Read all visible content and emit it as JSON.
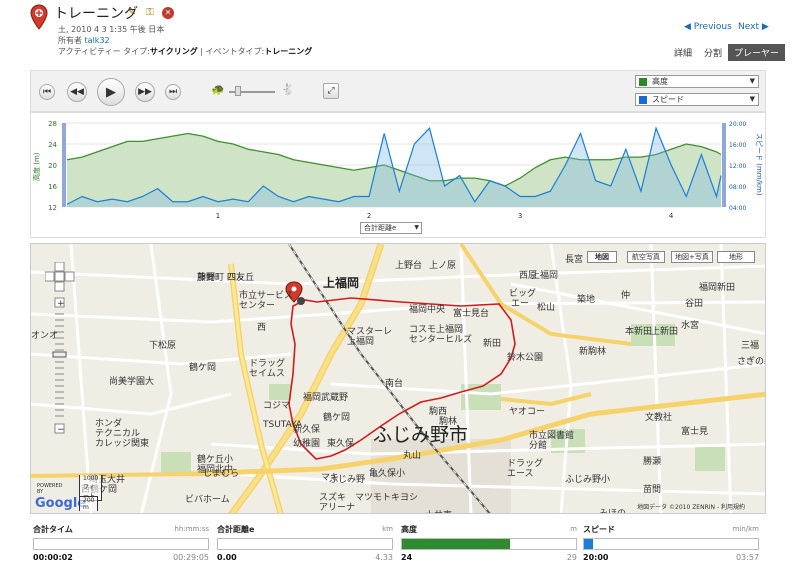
{
  "header": {
    "title": "トレーニング",
    "datetime": "土, 2010 4 3 1:35 午後 日本",
    "owner_label": "所有者",
    "owner_name": "talk32",
    "activity_type_label": "アクティビティー タイプ:",
    "activity_type": "サイクリング",
    "event_type_label": "| イベントタイプ:",
    "event_type": "トレーニング",
    "prev": "◀ Previous",
    "next": "Next ▶",
    "tabs": [
      "詳細",
      "分割",
      "プレーヤー"
    ],
    "active_tab": 2
  },
  "player": {
    "dropdown1": "高度",
    "dropdown2": "スピード",
    "color1": "#2a8a2a",
    "color2": "#1a6bd8"
  },
  "chart_data": {
    "type": "area",
    "series": [
      {
        "name": "高度",
        "unit": "m",
        "color": "#3f8f2f",
        "x": [
          0,
          0.1,
          0.2,
          0.3,
          0.4,
          0.5,
          0.6,
          0.7,
          0.8,
          0.9,
          1.0,
          1.1,
          1.2,
          1.3,
          1.4,
          1.5,
          1.6,
          1.7,
          1.8,
          1.9,
          2.0,
          2.1,
          2.2,
          2.3,
          2.4,
          2.5,
          2.6,
          2.7,
          2.8,
          2.9,
          3.0,
          3.1,
          3.2,
          3.3,
          3.4,
          3.5,
          3.6,
          3.7,
          3.8,
          3.9,
          4.0,
          4.1,
          4.2,
          4.3,
          4.33
        ],
        "values": [
          21,
          21.5,
          22.5,
          23.5,
          24.5,
          24.5,
          25,
          25.5,
          26,
          25.5,
          24.5,
          24,
          23,
          22.5,
          22,
          21,
          20.5,
          20,
          19.5,
          19,
          19.5,
          20,
          19,
          18,
          17,
          17,
          17.5,
          17.5,
          17,
          16,
          17.5,
          19.5,
          21,
          21.5,
          21,
          21,
          21,
          21.5,
          21.5,
          22,
          23,
          24,
          23.5,
          22.5,
          22
        ]
      },
      {
        "name": "スピード",
        "unit": "mm/km",
        "color": "#1a7fd8",
        "x": [
          0,
          0.1,
          0.2,
          0.3,
          0.4,
          0.5,
          0.6,
          0.7,
          0.8,
          0.9,
          1.0,
          1.1,
          1.2,
          1.3,
          1.4,
          1.5,
          1.6,
          1.7,
          1.8,
          1.9,
          2.0,
          2.1,
          2.2,
          2.3,
          2.4,
          2.5,
          2.6,
          2.7,
          2.8,
          2.9,
          3.0,
          3.1,
          3.2,
          3.3,
          3.4,
          3.5,
          3.6,
          3.7,
          3.8,
          3.9,
          4.0,
          4.1,
          4.2,
          4.3,
          4.33
        ],
        "values": [
          4.5,
          6,
          5,
          5.5,
          5,
          6,
          7.5,
          5,
          5,
          6,
          5,
          5.5,
          5,
          8,
          6,
          5,
          6,
          5.5,
          5,
          6,
          6,
          18,
          7,
          16,
          19,
          8,
          10,
          5,
          9,
          8,
          6,
          6,
          7,
          12,
          18,
          9,
          8,
          15,
          7,
          19,
          12,
          6,
          14,
          6,
          10
        ]
      }
    ],
    "x_ticks": [
      "1",
      "2",
      "3",
      "4"
    ],
    "y_left_ticks": [
      "28",
      "24",
      "20",
      "16",
      "12"
    ],
    "y_right_ticks": [
      "20:00",
      "16:00",
      "12:00",
      "08:00",
      "04:00"
    ],
    "ylabel_left": "高度 (m)",
    "ylabel_right": "スピード (mm/km)",
    "ylim_left": [
      12,
      28
    ],
    "ylim_right": [
      4,
      20
    ],
    "xlim": [
      0,
      4.33
    ],
    "x_selector": "合計距離e"
  },
  "map": {
    "type_buttons": [
      "地図",
      "航空写真",
      "地図+写真",
      "地形"
    ],
    "labels": [
      {
        "t": "熊野町",
        "c": "mt"
      },
      {
        "t": "藤間",
        "c": "mt"
      },
      {
        "t": "四友",
        "c": "mt"
      },
      {
        "t": "四友丘",
        "c": "mt"
      },
      {
        "t": "上福岡",
        "c": "mid"
      },
      {
        "t": "市立サービス",
        "c": "mt"
      },
      {
        "t": "センター",
        "c": "mt"
      },
      {
        "t": "マスターレ",
        "c": "mt"
      },
      {
        "t": "上福岡",
        "c": "mt"
      },
      {
        "t": "富士見台",
        "c": "mt"
      },
      {
        "t": "福岡中央",
        "c": "mt"
      },
      {
        "t": "コスモ上福岡",
        "c": "mt"
      },
      {
        "t": "センターヒルズ",
        "c": "mt"
      },
      {
        "t": "西原",
        "c": "mt"
      },
      {
        "t": "上福岡",
        "c": "mt"
      },
      {
        "t": "ビッグ",
        "c": "mt"
      },
      {
        "t": "エー",
        "c": "mt"
      },
      {
        "t": "松山",
        "c": "mt"
      },
      {
        "t": "築地",
        "c": "mt"
      },
      {
        "t": "仲",
        "c": "mt"
      },
      {
        "t": "谷田",
        "c": "mt"
      },
      {
        "t": "福岡新田",
        "c": "mt"
      },
      {
        "t": "本新田",
        "c": "mt"
      },
      {
        "t": "上新田",
        "c": "mt"
      },
      {
        "t": "水宮",
        "c": "mt"
      },
      {
        "t": "新駒林",
        "c": "mt"
      },
      {
        "t": "新田",
        "c": "mt"
      },
      {
        "t": "鈴木公園",
        "c": "mt"
      },
      {
        "t": "下松原",
        "c": "mt"
      },
      {
        "t": "西",
        "c": "mt"
      },
      {
        "t": "鶴ケ岡",
        "c": "mt"
      },
      {
        "t": "尚美学園大",
        "c": "mt"
      },
      {
        "t": "ドラッグ",
        "c": "mt"
      },
      {
        "t": "セイムス",
        "c": "mt"
      },
      {
        "t": "福岡武蔵野",
        "c": "mt"
      },
      {
        "t": "南台",
        "c": "mt"
      },
      {
        "t": "駒西",
        "c": "mt"
      },
      {
        "t": "ヤオコー",
        "c": "mt"
      },
      {
        "t": "コジマ",
        "c": "mt"
      },
      {
        "t": "TSUTAYA",
        "c": "mt"
      },
      {
        "t": "鶴ケ岡",
        "c": "mt"
      },
      {
        "t": "駒林",
        "c": "mt"
      },
      {
        "t": "ふじみ野市",
        "c": "big"
      },
      {
        "t": "東久保",
        "c": "mt"
      },
      {
        "t": "新久保",
        "c": "mt"
      },
      {
        "t": "幼稚園",
        "c": "mt"
      },
      {
        "t": "丸山",
        "c": "mt"
      },
      {
        "t": "市立図書館",
        "c": "mt"
      },
      {
        "t": "分館",
        "c": "mt"
      },
      {
        "t": "文教社",
        "c": "mt"
      },
      {
        "t": "富士見",
        "c": "mt"
      },
      {
        "t": "勝瀬",
        "c": "mt"
      },
      {
        "t": "ホンダ",
        "c": "mt"
      },
      {
        "t": "テクニカル",
        "c": "mt"
      },
      {
        "t": "カレッジ関東",
        "c": "mt"
      },
      {
        "t": "鶴ケ丘小",
        "c": "mt"
      },
      {
        "t": "福岡北中",
        "c": "mt"
      },
      {
        "t": "埼玉大井",
        "c": "mt"
      },
      {
        "t": "しまむら",
        "c": "mt"
      },
      {
        "t": "西鶴ケ岡",
        "c": "mt"
      },
      {
        "t": "ビバホーム",
        "c": "mt"
      },
      {
        "t": "ふじみ野",
        "c": "mt"
      },
      {
        "t": "亀久保小",
        "c": "mt"
      },
      {
        "t": "ドラッグ",
        "c": "mt"
      },
      {
        "t": "エース",
        "c": "mt"
      },
      {
        "t": "ふじみ野小",
        "c": "mt"
      },
      {
        "t": "苗間",
        "c": "mt"
      },
      {
        "t": "スズキ",
        "c": "mt"
      },
      {
        "t": "アリーナ",
        "c": "mt"
      },
      {
        "t": "マツモトキヨシ",
        "c": "mt"
      },
      {
        "t": "大井東",
        "c": "mt"
      },
      {
        "t": "みほの",
        "c": "mt"
      },
      {
        "t": "上野台",
        "c": "mt"
      },
      {
        "t": "上ノ原",
        "c": "mt"
      },
      {
        "t": "長宮",
        "c": "mt"
      },
      {
        "t": "さぎの森小",
        "c": "mt"
      },
      {
        "t": "三福",
        "c": "mt"
      },
      {
        "t": "オンオ",
        "c": "mt"
      },
      {
        "t": "マキ",
        "c": "mt"
      }
    ],
    "scale_ft": "1000 フィート",
    "scale_m": "200 m",
    "google": "Google",
    "powered": "POWERED BY",
    "copyright": "地図データ ©2010 ZENRIN - 利用規約"
  },
  "stats": [
    {
      "label": "合計タイム",
      "unit": "hh:mm:ss",
      "value": "00:00:02",
      "max": "00:29:05",
      "fill": 0.0,
      "color": "#888888"
    },
    {
      "label": "合計距離e",
      "unit": "km",
      "value": "0.00",
      "max": "4.33",
      "fill": 0.0,
      "color": "#888888"
    },
    {
      "label": "高度",
      "unit": "m",
      "value": "24",
      "max": "29",
      "fill": 0.62,
      "color": "#2e8b2e"
    },
    {
      "label": "スピード",
      "unit": "min/km",
      "value": "20:00",
      "max": "03:57",
      "fill": 0.05,
      "color": "#1a7fd8"
    }
  ]
}
